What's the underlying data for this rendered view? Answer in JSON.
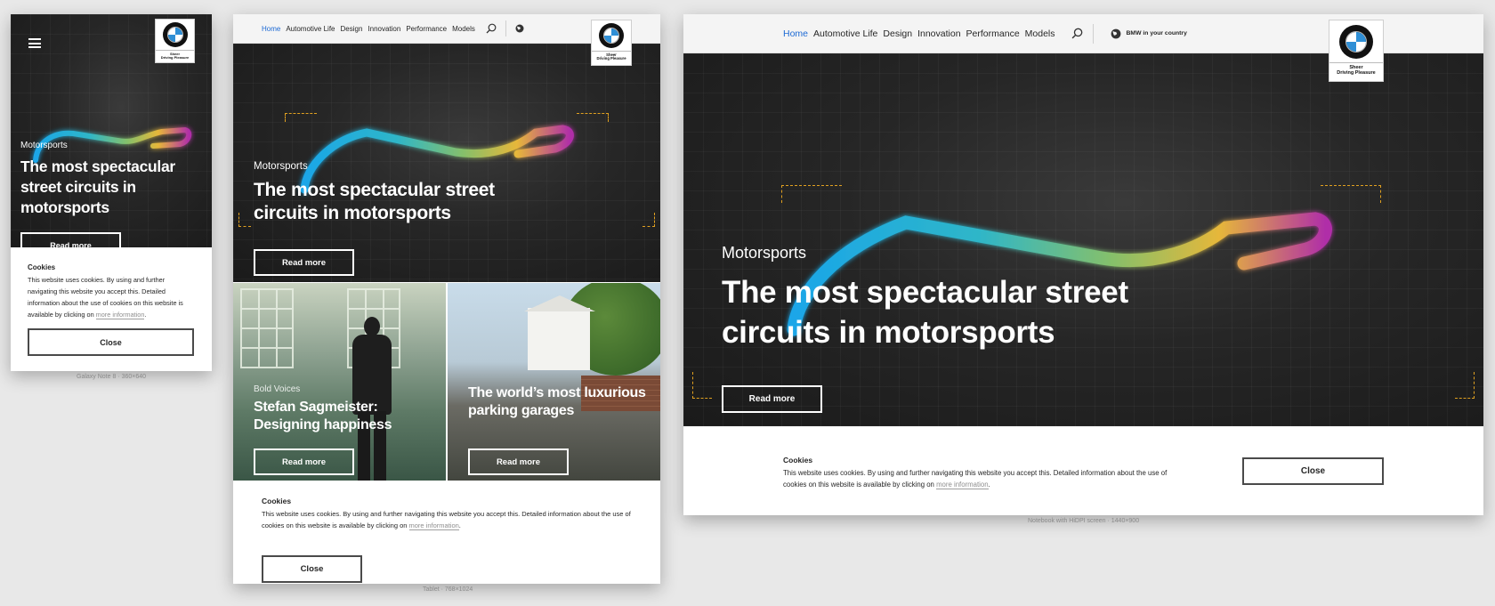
{
  "logo": {
    "tagline_1": "Sheer",
    "tagline_2": "Driving Pleasure"
  },
  "nav": {
    "items": [
      "Home",
      "Automotive Life",
      "Design",
      "Innovation",
      "Performance",
      "Models"
    ],
    "country_label": "BMW in your country"
  },
  "hero": {
    "eyebrow": "Motorsports",
    "headline": "The most spectacular street circuits in motorsports",
    "cta": "Read more"
  },
  "tiles": [
    {
      "eyebrow": "Bold Voices",
      "headline": "Stefan Sagmeister: Designing happiness",
      "cta": "Read more"
    },
    {
      "eyebrow": "",
      "headline": "The world’s most luxurious parking garages",
      "cta": "Read more"
    }
  ],
  "cookie": {
    "title": "Cookies",
    "text": "This website uses cookies. By using and further navigating this website you accept this. Detailed information about the use of cookies on this website is available by clicking on",
    "link": "more information",
    "suffix": ".",
    "close": "Close"
  },
  "captions": {
    "phone": "Galaxy Note 8 · 360×640",
    "tablet": "Tablet · 768×1024",
    "notebook": "Notebook with HiDPI screen · 1440×900"
  },
  "colors": {
    "accent": "#1c69d4",
    "bracket": "#e0a020",
    "hero_bg": "#262626"
  },
  "icons": {
    "menu": "hamburger-icon",
    "search": "search-icon",
    "globe": "globe-icon"
  }
}
